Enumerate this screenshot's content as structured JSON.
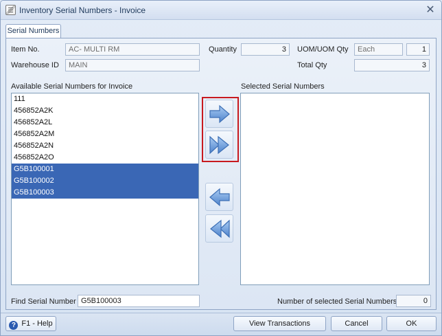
{
  "window": {
    "title": "Inventory Serial Numbers - Invoice",
    "close_glyph": "✕"
  },
  "tab": {
    "label": "Serial Numbers"
  },
  "form": {
    "item_no_label": "Item No.",
    "item_no_value": "AC- MULTI RM",
    "warehouse_label": "Warehouse ID",
    "warehouse_value": "MAIN",
    "quantity_label": "Quantity",
    "quantity_value": "3",
    "uom_label": "UOM/UOM Qty",
    "uom_value": "Each",
    "uom_qty_value": "1",
    "total_qty_label": "Total Qty",
    "total_qty_value": "3"
  },
  "available": {
    "label": "Available Serial Numbers for Invoice",
    "items": [
      {
        "text": "111",
        "selected": false
      },
      {
        "text": "456852A2K",
        "selected": false
      },
      {
        "text": "456852A2L",
        "selected": false
      },
      {
        "text": "456852A2M",
        "selected": false
      },
      {
        "text": "456852A2N",
        "selected": false
      },
      {
        "text": "456852A2O",
        "selected": false
      },
      {
        "text": "G5B100001",
        "selected": true
      },
      {
        "text": "G5B100002",
        "selected": true
      },
      {
        "text": "G5B100003",
        "selected": true
      }
    ]
  },
  "selected_list": {
    "label": "Selected Serial Numbers",
    "items": []
  },
  "transfer_buttons": {
    "move_right_icon": "arrow-right-icon",
    "move_all_right_icon": "double-arrow-right-icon",
    "move_left_icon": "arrow-left-icon",
    "move_all_left_icon": "double-arrow-left-icon"
  },
  "find": {
    "label": "Find Serial Number",
    "value": "G5B100003"
  },
  "count": {
    "label": "Number of selected Serial Numbers",
    "value": "0"
  },
  "footer": {
    "help_label": "F1 - Help",
    "view_transactions_label": "View Transactions",
    "cancel_label": "Cancel",
    "ok_label": "OK"
  },
  "colors": {
    "selection": "#3a67b5",
    "highlight_border": "#c8191f",
    "arrow_fill": "#5b8fd6"
  }
}
